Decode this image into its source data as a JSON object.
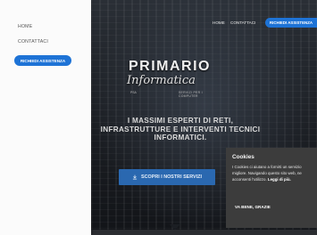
{
  "sidebar": {
    "links": [
      "HOME",
      "CONTATTACI"
    ],
    "button_label": "RICHIEDI ASSISTENZA"
  },
  "top_nav": {
    "links": [
      "HOME",
      "CONTATTACI"
    ],
    "button_label": "RICHIEDI ASSISTENZA"
  },
  "logo": {
    "primary": "PRIMARIO",
    "script": "Informatica",
    "tag": "PSA",
    "sub": "SERVIZI PER I COMPUTER"
  },
  "hero": {
    "headline_lines": [
      "I MASSIMI ESPERTI DI RETI,",
      "INFRASTRUTTURE E INTERVENTI TECNICI",
      "INFORMATICI."
    ],
    "cta_label": "SCOPRI I NOSTRI SERVIZI"
  },
  "cookie": {
    "title": "Cookies",
    "text": "I Cookies ci aiutano a fornirti un servizio migliore. Navigando questo sito web, ne acconsenti l'utilizzo.",
    "link": "Leggi di più.",
    "button": "VA BENE, GRAZIE"
  },
  "colors": {
    "accent": "#1e73d6",
    "sidebar_bg": "#fbfbfb",
    "cookie_bg": "#3c3c3c"
  }
}
